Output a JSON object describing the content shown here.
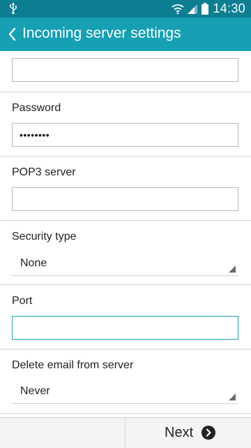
{
  "status_bar": {
    "time": "14:30",
    "icons": [
      "usb-icon",
      "wifi-icon",
      "signal-icon",
      "battery-icon"
    ]
  },
  "app_bar": {
    "title": "Incoming server settings"
  },
  "form": {
    "username_value": "",
    "password_label": "Password",
    "password_value": "••••••••",
    "pop3_label": "POP3 server",
    "pop3_value": "",
    "security_label": "Security type",
    "security_value": "None",
    "port_label": "Port",
    "port_value": "",
    "delete_label": "Delete email from server",
    "delete_value": "Never"
  },
  "footer": {
    "next_label": "Next"
  },
  "colors": {
    "status_bar": "#0b7e92",
    "app_bar": "#15a0b4",
    "focus_border": "#1c9fb3"
  }
}
